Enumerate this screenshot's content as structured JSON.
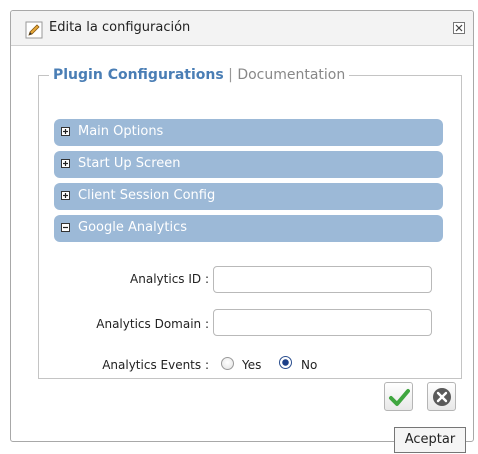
{
  "window": {
    "title": "Edita la configuración",
    "icon": "pencil-icon",
    "close_icon": "close-icon"
  },
  "tabs": {
    "active": "Plugin Configurations",
    "separator": "|",
    "other": "Documentation"
  },
  "sections": [
    {
      "label": "Main Options",
      "state": "collapsed"
    },
    {
      "label": "Start Up Screen",
      "state": "collapsed"
    },
    {
      "label": "Client Session Config",
      "state": "collapsed"
    },
    {
      "label": "Google Analytics",
      "state": "expanded"
    }
  ],
  "form": {
    "analytics_id": {
      "label": "Analytics ID :",
      "value": ""
    },
    "analytics_domain": {
      "label": "Analytics Domain :",
      "value": ""
    },
    "analytics_events": {
      "label": "Analytics Events :",
      "options": [
        "Yes",
        "No"
      ],
      "selected": "No"
    }
  },
  "actions": {
    "accept_icon": "checkmark-icon",
    "cancel_icon": "cancel-icon",
    "tooltip": "Aceptar"
  },
  "colors": {
    "section_header": "#9cb9d7",
    "active_tab": "#4a7eb5",
    "accept_green": "#3fa63f"
  }
}
